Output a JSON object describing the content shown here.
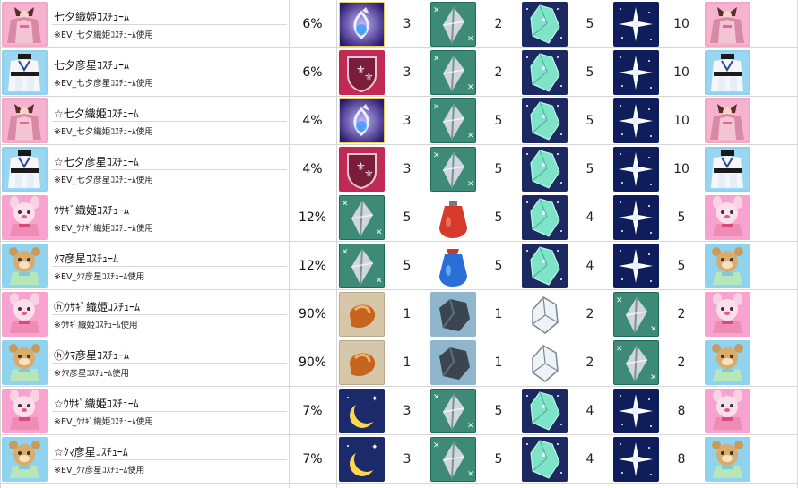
{
  "columns": {
    "name": "item",
    "rate": "rate",
    "m1": "material-1",
    "m2": "material-2",
    "m3": "material-3",
    "m4": "material-4"
  },
  "colors": {
    "pink_bg": "#f3a3c6",
    "blue_bg": "#8fd0ef",
    "grid": "#d6d6d6"
  },
  "rows": [
    {
      "name": "七夕織姫ｺｽﾁｭｰﾑ",
      "sub": "※EV_七夕織姫ｺｽﾁｭｰﾑ使用",
      "avatar": "orihime",
      "rate": "6%",
      "m1": {
        "icon": "purple-flame-orb",
        "qty": "3"
      },
      "m2": {
        "icon": "crystal-shard",
        "qty": "2"
      },
      "m3": {
        "icon": "sparkle-gem",
        "qty": "5"
      },
      "m4": {
        "icon": "star-sparkle",
        "qty": "10"
      }
    },
    {
      "name": "七夕彦星ｺｽﾁｭｰﾑ",
      "sub": "※EV_七夕彦星ｺｽﾁｭｰﾑ使用",
      "avatar": "hikoboshi",
      "rate": "6%",
      "m1": {
        "icon": "fleur-de-lis-emblem",
        "qty": "3"
      },
      "m2": {
        "icon": "crystal-shard",
        "qty": "2"
      },
      "m3": {
        "icon": "sparkle-gem",
        "qty": "5"
      },
      "m4": {
        "icon": "star-sparkle",
        "qty": "10"
      }
    },
    {
      "name": "☆七夕織姫ｺｽﾁｭｰﾑ",
      "sub": "※EV_七夕織姫ｺｽﾁｭｰﾑ使用",
      "avatar": "orihime",
      "rate": "4%",
      "m1": {
        "icon": "purple-flame-orb",
        "qty": "3"
      },
      "m2": {
        "icon": "crystal-shard",
        "qty": "5"
      },
      "m3": {
        "icon": "sparkle-gem",
        "qty": "5"
      },
      "m4": {
        "icon": "star-sparkle",
        "qty": "10"
      }
    },
    {
      "name": "☆七夕彦星ｺｽﾁｭｰﾑ",
      "sub": "※EV_七夕彦星ｺｽﾁｭｰﾑ使用",
      "avatar": "hikoboshi",
      "rate": "4%",
      "m1": {
        "icon": "fleur-de-lis-emblem",
        "qty": "3"
      },
      "m2": {
        "icon": "crystal-shard",
        "qty": "5"
      },
      "m3": {
        "icon": "sparkle-gem",
        "qty": "5"
      },
      "m4": {
        "icon": "star-sparkle",
        "qty": "10"
      }
    },
    {
      "name": "ｳｻｷﾞ織姫ｺｽﾁｭｰﾑ",
      "sub": "※EV_ｳｻｷﾞ織姫ｺｽﾁｭｰﾑ使用",
      "avatar": "rabbit",
      "rate": "12%",
      "m1": {
        "icon": "crystal-shard",
        "qty": "5"
      },
      "m2": {
        "icon": "red-potion",
        "qty": "5"
      },
      "m3": {
        "icon": "sparkle-gem",
        "qty": "4"
      },
      "m4": {
        "icon": "star-sparkle",
        "qty": "5"
      }
    },
    {
      "name": "ｸﾏ彦星ｺｽﾁｭｰﾑ",
      "sub": "※EV_ｸﾏ彦星ｺｽﾁｭｰﾑ使用",
      "avatar": "bear",
      "rate": "12%",
      "m1": {
        "icon": "crystal-shard",
        "qty": "5"
      },
      "m2": {
        "icon": "blue-potion",
        "qty": "5"
      },
      "m3": {
        "icon": "sparkle-gem",
        "qty": "4"
      },
      "m4": {
        "icon": "star-sparkle",
        "qty": "5"
      }
    },
    {
      "name": "ⓗｳｻｷﾞ織姫ｺｽﾁｭｰﾑ",
      "sub": "※ｳｻｷﾞ織姫ｺｽﾁｭｰﾑ使用",
      "avatar": "rabbit",
      "rate": "90%",
      "m1": {
        "icon": "copper-ingot",
        "qty": "1"
      },
      "m2": {
        "icon": "dark-ore",
        "qty": "1"
      },
      "m3": {
        "icon": "clear-crystal",
        "qty": "2"
      },
      "m4": {
        "icon": "crystal-shard",
        "qty": "2"
      }
    },
    {
      "name": "ⓗｸﾏ彦星ｺｽﾁｭｰﾑ",
      "sub": "※ｸﾏ彦星ｺｽﾁｭｰﾑ使用",
      "avatar": "bear",
      "rate": "90%",
      "m1": {
        "icon": "copper-ingot",
        "qty": "1"
      },
      "m2": {
        "icon": "dark-ore",
        "qty": "1"
      },
      "m3": {
        "icon": "clear-crystal",
        "qty": "2"
      },
      "m4": {
        "icon": "crystal-shard",
        "qty": "2"
      }
    },
    {
      "name": "☆ｳｻｷﾞ織姫ｺｽﾁｭｰﾑ",
      "sub": "※EV_ｳｻｷﾞ織姫ｺｽﾁｭｰﾑ使用",
      "avatar": "rabbit",
      "rate": "7%",
      "m1": {
        "icon": "crescent-moon",
        "qty": "3"
      },
      "m2": {
        "icon": "crystal-shard",
        "qty": "5"
      },
      "m3": {
        "icon": "sparkle-gem",
        "qty": "4"
      },
      "m4": {
        "icon": "star-sparkle",
        "qty": "8"
      }
    },
    {
      "name": "☆ｸﾏ彦星ｺｽﾁｭｰﾑ",
      "sub": "※EV_ｸﾏ彦星ｺｽﾁｭｰﾑ使用",
      "avatar": "bear",
      "rate": "7%",
      "m1": {
        "icon": "crescent-moon",
        "qty": "3"
      },
      "m2": {
        "icon": "crystal-shard",
        "qty": "5"
      },
      "m3": {
        "icon": "sparkle-gem",
        "qty": "4"
      },
      "m4": {
        "icon": "star-sparkle",
        "qty": "8"
      }
    }
  ]
}
